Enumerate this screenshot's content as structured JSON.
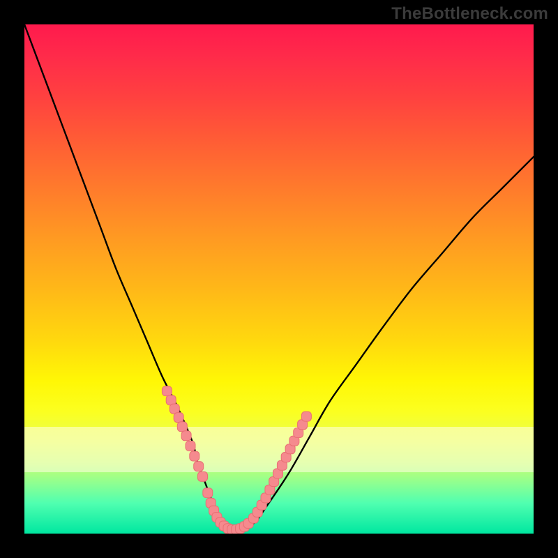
{
  "watermark": "TheBottleneck.com",
  "colors": {
    "frame": "#000000",
    "curve": "#000000",
    "marker_fill": "#f58a8e",
    "marker_stroke": "#e96f74"
  },
  "chart_data": {
    "type": "line",
    "title": "",
    "xlabel": "",
    "ylabel": "",
    "xlim": [
      0,
      100
    ],
    "ylim": [
      0,
      100
    ],
    "grid": false,
    "legend": false,
    "annotations": [],
    "series": [
      {
        "name": "bottleneck-curve",
        "x": [
          0,
          3,
          6,
          9,
          12,
          15,
          18,
          21,
          24,
          27,
          30,
          33,
          34,
          35.5,
          37,
          38.5,
          40,
          42,
          45,
          48,
          52,
          56,
          60,
          65,
          70,
          76,
          82,
          88,
          94,
          100
        ],
        "y": [
          100,
          92,
          84,
          76,
          68,
          60,
          52,
          45,
          38,
          31,
          25,
          18,
          14,
          10,
          6,
          3,
          0.8,
          0.5,
          2,
          6,
          12,
          19,
          26,
          33,
          40,
          48,
          55,
          62,
          68,
          74
        ]
      }
    ],
    "marker_clusters": [
      {
        "name": "left-descent-markers",
        "points": [
          {
            "x": 28.0,
            "y": 28.0
          },
          {
            "x": 28.8,
            "y": 26.2
          },
          {
            "x": 29.5,
            "y": 24.5
          },
          {
            "x": 30.3,
            "y": 22.8
          },
          {
            "x": 31.0,
            "y": 21.0
          },
          {
            "x": 31.8,
            "y": 19.2
          },
          {
            "x": 32.6,
            "y": 17.2
          },
          {
            "x": 33.4,
            "y": 15.2
          },
          {
            "x": 34.2,
            "y": 13.2
          },
          {
            "x": 35.0,
            "y": 11.2
          }
        ]
      },
      {
        "name": "trough-markers",
        "points": [
          {
            "x": 36.0,
            "y": 8.0
          },
          {
            "x": 36.6,
            "y": 6.0
          },
          {
            "x": 37.2,
            "y": 4.5
          },
          {
            "x": 37.8,
            "y": 3.2
          },
          {
            "x": 38.5,
            "y": 2.2
          },
          {
            "x": 39.2,
            "y": 1.5
          },
          {
            "x": 40.0,
            "y": 1.0
          },
          {
            "x": 40.8,
            "y": 0.8
          },
          {
            "x": 41.6,
            "y": 0.8
          },
          {
            "x": 42.4,
            "y": 1.0
          },
          {
            "x": 43.2,
            "y": 1.4
          },
          {
            "x": 44.0,
            "y": 2.0
          }
        ]
      },
      {
        "name": "right-ascent-markers",
        "points": [
          {
            "x": 45.0,
            "y": 3.0
          },
          {
            "x": 45.8,
            "y": 4.2
          },
          {
            "x": 46.6,
            "y": 5.6
          },
          {
            "x": 47.4,
            "y": 7.0
          },
          {
            "x": 48.2,
            "y": 8.6
          },
          {
            "x": 49.0,
            "y": 10.2
          },
          {
            "x": 49.8,
            "y": 11.8
          },
          {
            "x": 50.6,
            "y": 13.4
          },
          {
            "x": 51.4,
            "y": 15.0
          },
          {
            "x": 52.2,
            "y": 16.6
          },
          {
            "x": 53.0,
            "y": 18.2
          },
          {
            "x": 53.8,
            "y": 19.8
          },
          {
            "x": 54.6,
            "y": 21.4
          },
          {
            "x": 55.4,
            "y": 23.0
          }
        ]
      }
    ]
  }
}
